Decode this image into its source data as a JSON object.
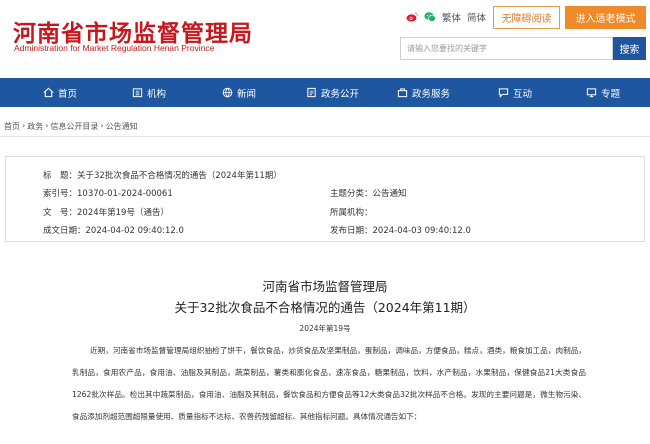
{
  "header": {
    "logo_cn": "河南省市场监督管理局",
    "logo_en": "Administration for Market Regulation Henan Province",
    "traditional": "繁体",
    "simplified": "简体",
    "accessibility_btn": "无障碍阅读",
    "elder_btn": "进入适老模式",
    "search_placeholder": "请输入您要找的关键字",
    "search_btn": "搜索"
  },
  "nav": {
    "items": [
      {
        "label": "首页",
        "icon": "home-icon"
      },
      {
        "label": "机构",
        "icon": "building-icon"
      },
      {
        "label": "新闻",
        "icon": "globe-icon"
      },
      {
        "label": "政务公开",
        "icon": "document-icon"
      },
      {
        "label": "政务服务",
        "icon": "service-icon"
      },
      {
        "label": "互动",
        "icon": "chat-icon"
      },
      {
        "label": "专题",
        "icon": "monitor-icon"
      }
    ]
  },
  "breadcrumb": [
    "首页",
    "政务",
    "信息公开目录",
    "公告通知"
  ],
  "breadcrumb_sep": "›",
  "info": {
    "title_label": "标　题：",
    "title_value": "关于32批次食品不合格情况的通告（2024年第11期）",
    "index_label": "索引号：",
    "index_value": "10370-01-2024-00061",
    "category_label": "主题分类：",
    "category_value": "公告通知",
    "docno_label": "文　号：",
    "docno_value": "2024年第19号（通告）",
    "org_label": "所属机构：",
    "org_value": "",
    "created_label": "成文日期：",
    "created_value": "2024-04-02 09:40:12.0",
    "published_label": "发布日期：",
    "published_value": "2024-04-03 09:40:12.0"
  },
  "article": {
    "heading1": "河南省市场监督管理局",
    "heading2": "关于32批次食品不合格情况的通告（2024年第11期）",
    "number": "2024年第19号",
    "body": "近期，河南省市场监督管理局组织抽检了饼干，餐饮食品，炒货食品及坚果制品，蛋制品，调味品，方便食品，糕点，酒类，粮食加工品，肉制品，乳制品，食用农产品，食用油、油脂及其制品，蔬菜制品，薯类和膨化食品，速冻食品，糖果制品，饮料，水产制品，水果制品，保健食品21大类食品1262批次样品。检出其中蔬菜制品，食用油、油脂及其制品，餐饮食品和方便食品等12大类食品32批次样品不合格。发现的主要问题是，微生物污染、食品添加剂超范围超限量使用、质量指标不达标、农兽药残留超标、其他指标问题。具体情况通告如下："
  },
  "colors": {
    "brand_red": "#c8161d",
    "nav_blue": "#1e56a0",
    "accent_orange": "#ef8a2a"
  }
}
